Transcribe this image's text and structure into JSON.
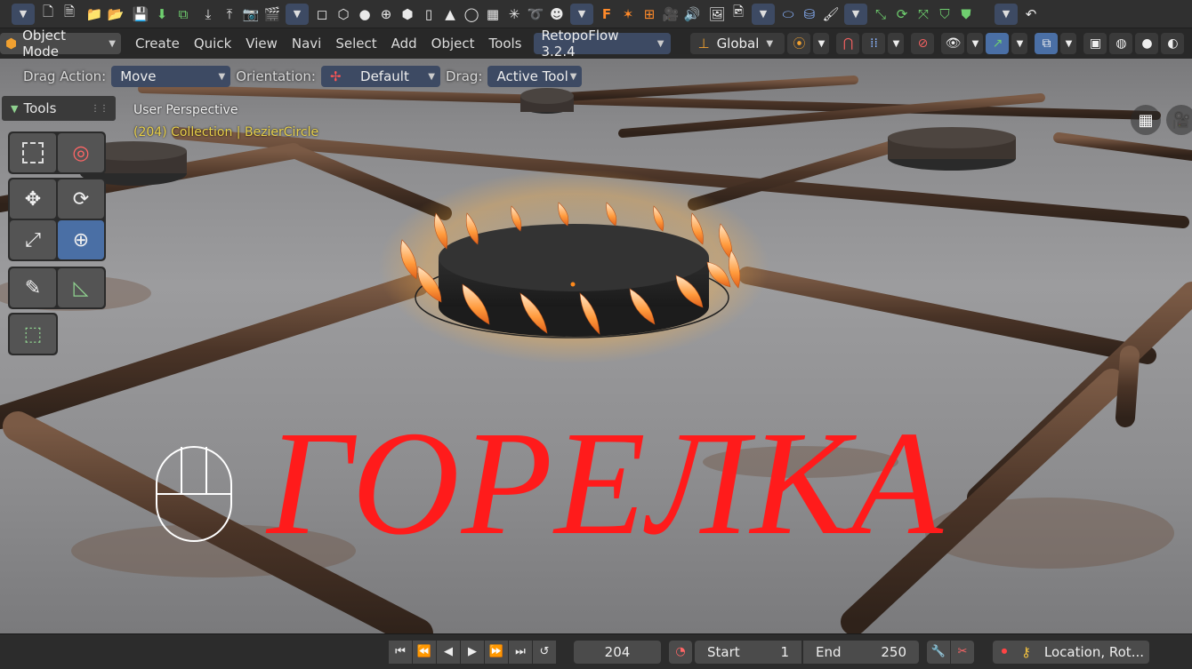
{
  "toolbar": {
    "icons": [
      "chevron-down",
      "new-file",
      "file",
      "open-folder",
      "open-recent",
      "save",
      "save-as",
      "save-copy",
      "import",
      "export",
      "render-image",
      "render-animation",
      "chevron-down",
      "cube-solid",
      "cube-wire",
      "sphere",
      "globe",
      "icosphere",
      "cylinder",
      "cone",
      "torus",
      "grid",
      "empty",
      "rope",
      "monkey",
      "chevron-down",
      "text-F",
      "armature",
      "lattice",
      "camera",
      "speaker",
      "image-editor",
      "uv-editor",
      "chevron-down",
      "object-link",
      "material",
      "brush",
      "chevron-down",
      "snap",
      "refresh",
      "shrink",
      "shield",
      "select-shield",
      "chevron-down",
      "undo"
    ]
  },
  "header": {
    "mode": "Object Mode",
    "menus": [
      "Create",
      "Quick",
      "View",
      "Navi",
      "Select",
      "Add",
      "Object",
      "Tools"
    ],
    "addon": "RetopoFlow 3.2.4",
    "orientation": "Global"
  },
  "tool_settings": {
    "drag_action_label": "Drag Action:",
    "drag_action_value": "Move",
    "orientation_label": "Orientation:",
    "orientation_value": "Default",
    "drag_label": "Drag:",
    "drag_value": "Active Tool"
  },
  "tools_panel": {
    "title": "Tools",
    "tools": [
      "select-box",
      "cursor",
      "move",
      "rotate",
      "scale",
      "transform",
      "annotate",
      "measure",
      "add-cube"
    ],
    "active_tool": "transform"
  },
  "viewport": {
    "view_name": "User Perspective",
    "collection_info": "(204) Collection | BezierCircle",
    "overlay_title": "ГОРЕЛКА",
    "overlay_color": "#ff1b1b"
  },
  "timeline": {
    "current_frame": "204",
    "start_label": "Start",
    "start_value": "1",
    "end_label": "End",
    "end_value": "250",
    "keying_label": "Location, Rot..."
  }
}
